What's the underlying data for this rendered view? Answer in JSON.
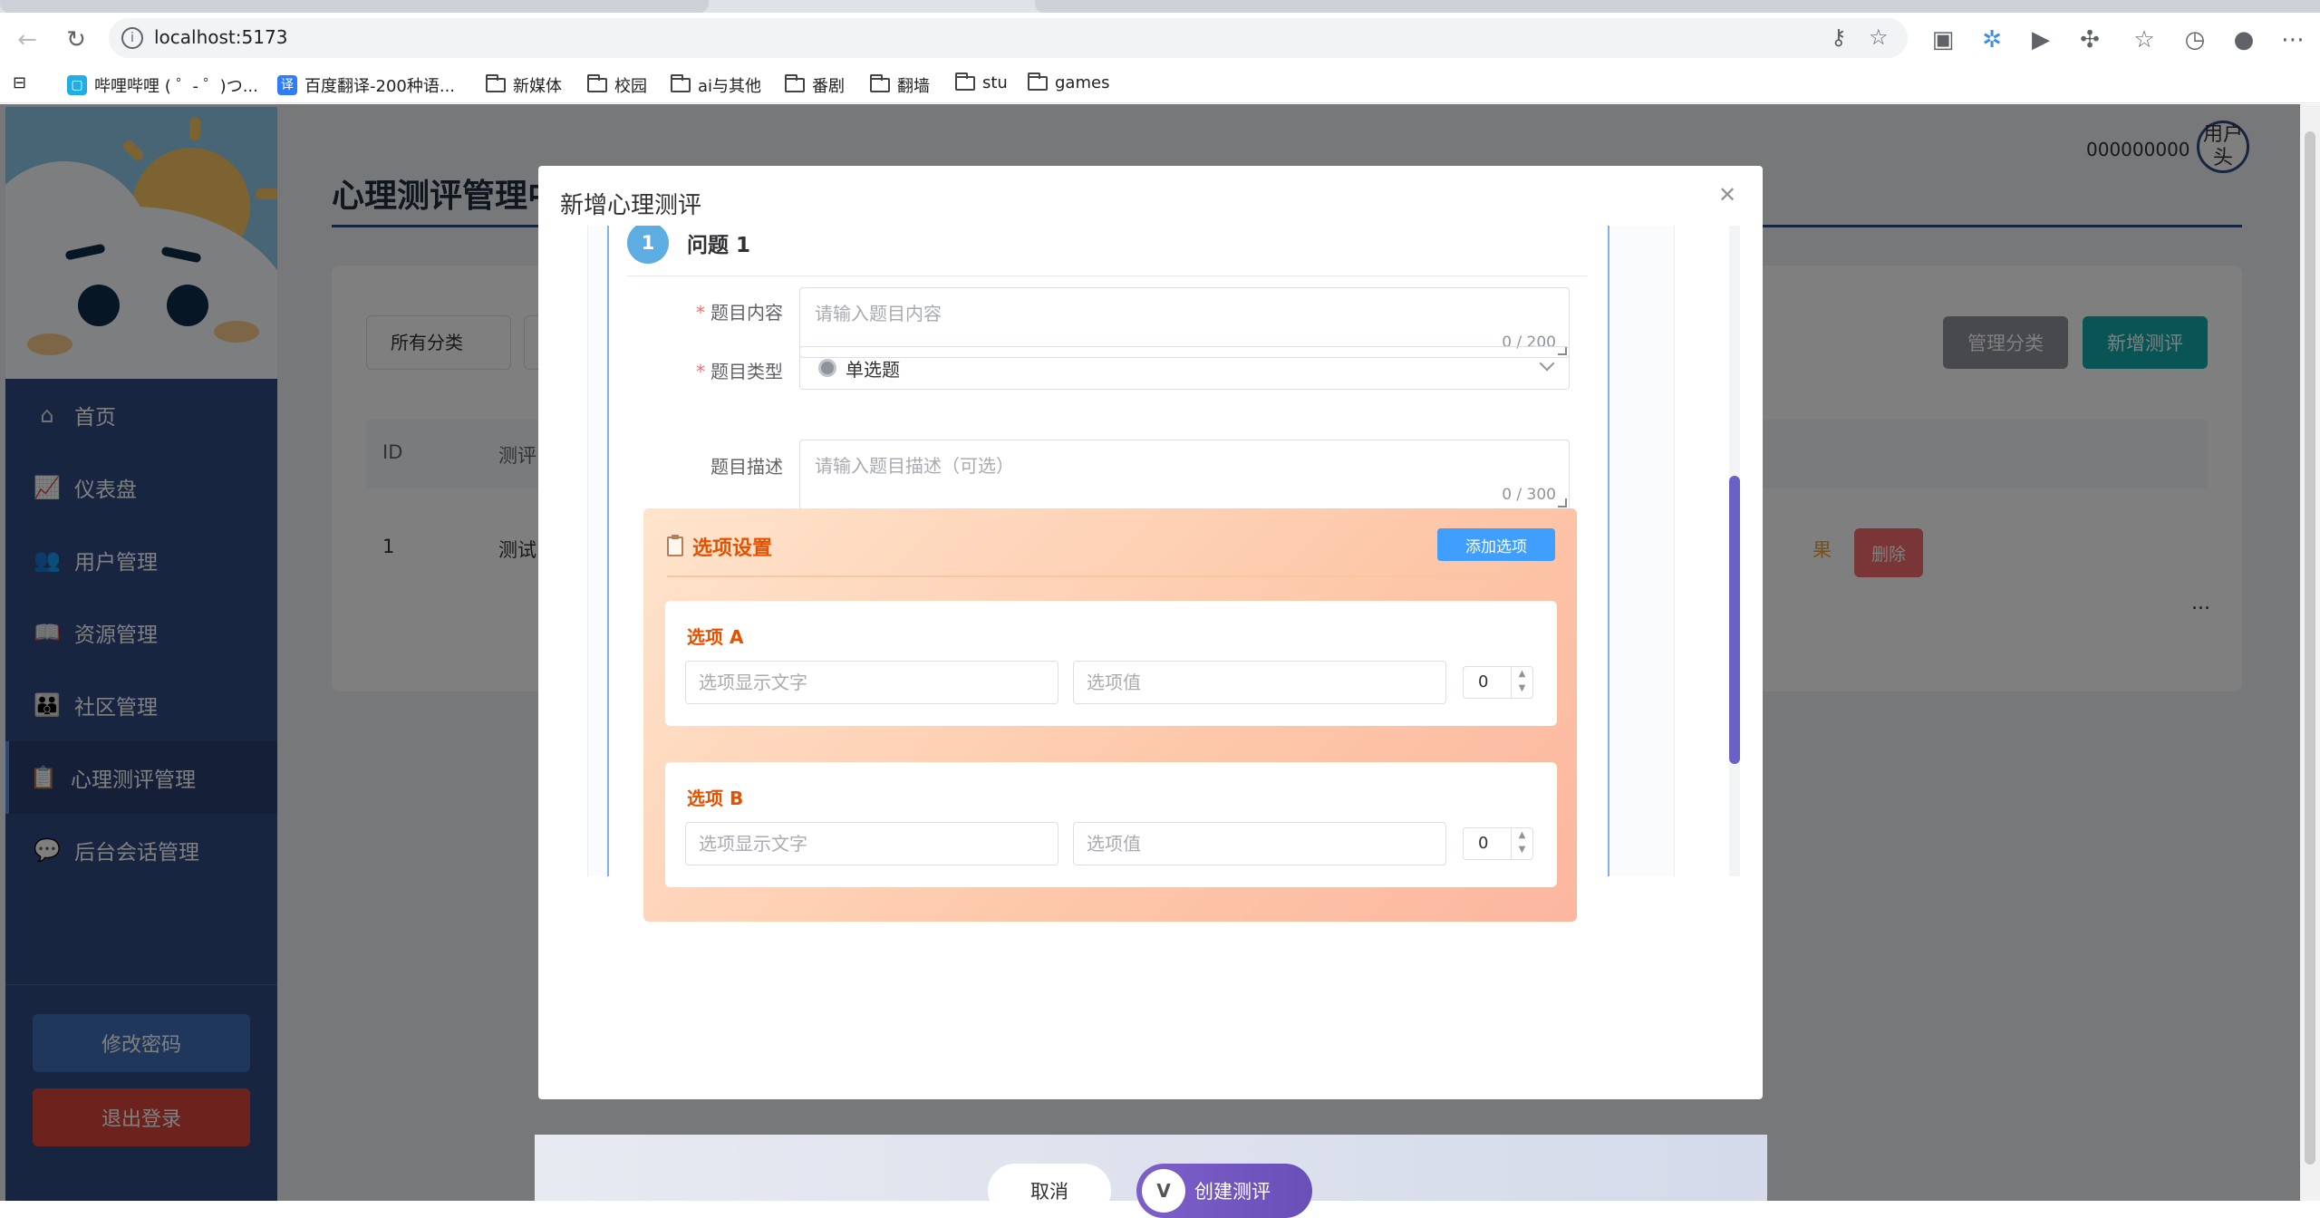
{
  "browser": {
    "url": "localhost:5173",
    "bookmarks": [
      "哔哩哔哩 ( ゜- ゜)つ...",
      "百度翻译-200种语...",
      "新媒体",
      "校园",
      "ai与其他",
      "番剧",
      "翻墙",
      "stu",
      "games"
    ]
  },
  "sidebar": {
    "items": [
      {
        "label": "首页",
        "icon": "home-icon"
      },
      {
        "label": "仪表盘",
        "icon": "chart-icon"
      },
      {
        "label": "用户管理",
        "icon": "users-icon"
      },
      {
        "label": "资源管理",
        "icon": "book-icon"
      },
      {
        "label": "社区管理",
        "icon": "group-icon"
      },
      {
        "label": "心理测评管理",
        "icon": "clipboard-icon"
      },
      {
        "label": "后台会话管理",
        "icon": "chat-icon"
      }
    ],
    "change_password": "修改密码",
    "logout": "退出登录"
  },
  "header": {
    "title": "心理测评管理中心",
    "user_id": "000000000",
    "avatar_alt": "用户头"
  },
  "toolbar": {
    "category_select": "所有分类",
    "manage_category": "管理分类",
    "add_assessment": "新增测评"
  },
  "table": {
    "headers": [
      "ID",
      "测评"
    ],
    "row": {
      "id": "1",
      "name": "测试",
      "action_partial": "果",
      "delete": "删除"
    },
    "more": "..."
  },
  "dialog": {
    "title": "新增心理测评",
    "question": {
      "number": "1",
      "title": "问题 1",
      "content_label": "题目内容",
      "content_placeholder": "请输入题目内容",
      "content_count": "0 / 200",
      "type_label": "题目类型",
      "type_value": "单选题",
      "desc_label": "题目描述",
      "desc_placeholder": "请输入题目描述（可选）",
      "desc_count": "0 / 300"
    },
    "options": {
      "title": "选项设置",
      "add_label": "添加选项",
      "items": [
        {
          "label": "选项 A",
          "text_placeholder": "选项显示文字",
          "value_placeholder": "选项值",
          "score": "0"
        },
        {
          "label": "选项 B",
          "text_placeholder": "选项显示文字",
          "value_placeholder": "选项值",
          "score": "0"
        }
      ]
    },
    "cancel": "取消",
    "create": "创建测评"
  },
  "colors": {
    "primary": "#409eff",
    "sidebar": "#304a80",
    "teal": "#13a8a8",
    "danger": "#f56c6c",
    "accent_orange": "#e65100"
  }
}
